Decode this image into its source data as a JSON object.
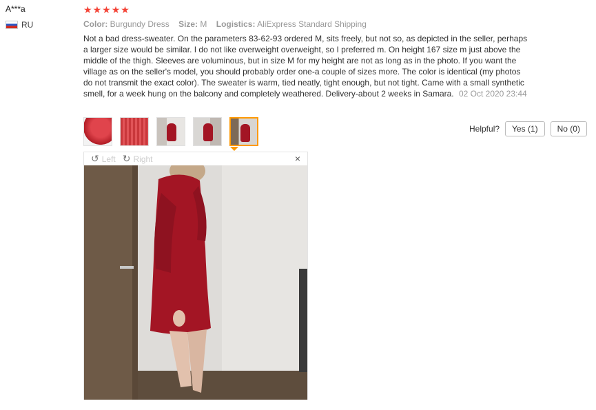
{
  "reviewer": {
    "name": "A***a",
    "country": "RU",
    "flag_icon": "russia-flag-icon"
  },
  "rating": {
    "stars": 5,
    "star_icon": "star-icon",
    "color": "#f44336"
  },
  "attributes": {
    "color_label": "Color:",
    "color_value": "Burgundy Dress",
    "size_label": "Size:",
    "size_value": "M",
    "logistics_label": "Logistics:",
    "logistics_value": "AliExpress Standard Shipping"
  },
  "review": {
    "text": "Not a bad dress-sweater. On the parameters 83-62-93 ordered M, sits freely, but not so, as depicted in the seller, perhaps a larger size would be similar. I do not like overweight overweight, so I preferred m. On height 167 size m just above the middle of the thigh. Sleeves are voluminous, but in size M for my height are not as long as in the photo. If you want the village as on the seller's model, you should probably order one-a couple of sizes more. The color is identical (my photos do not transmit the exact color). The sweater is warm, tied neatly, tight enough, but not tight. Came with a small synthetic smell, for a week hung on the balcony and completely weathered. Delivery-about 2 weeks in Samara.",
    "date": "02 Oct 2020 23:44"
  },
  "thumbnails": [
    {
      "name": "photo-thumb-1"
    },
    {
      "name": "photo-thumb-2"
    },
    {
      "name": "photo-thumb-3"
    },
    {
      "name": "photo-thumb-4"
    },
    {
      "name": "photo-thumb-5",
      "active": true
    }
  ],
  "helpful": {
    "label": "Helpful?",
    "yes": "Yes (1)",
    "no": "No (0)"
  },
  "viewer": {
    "left": "Left",
    "right": "Right",
    "close": "×"
  },
  "colors": {
    "accent": "#ff9900",
    "sweater": "#a31524"
  }
}
